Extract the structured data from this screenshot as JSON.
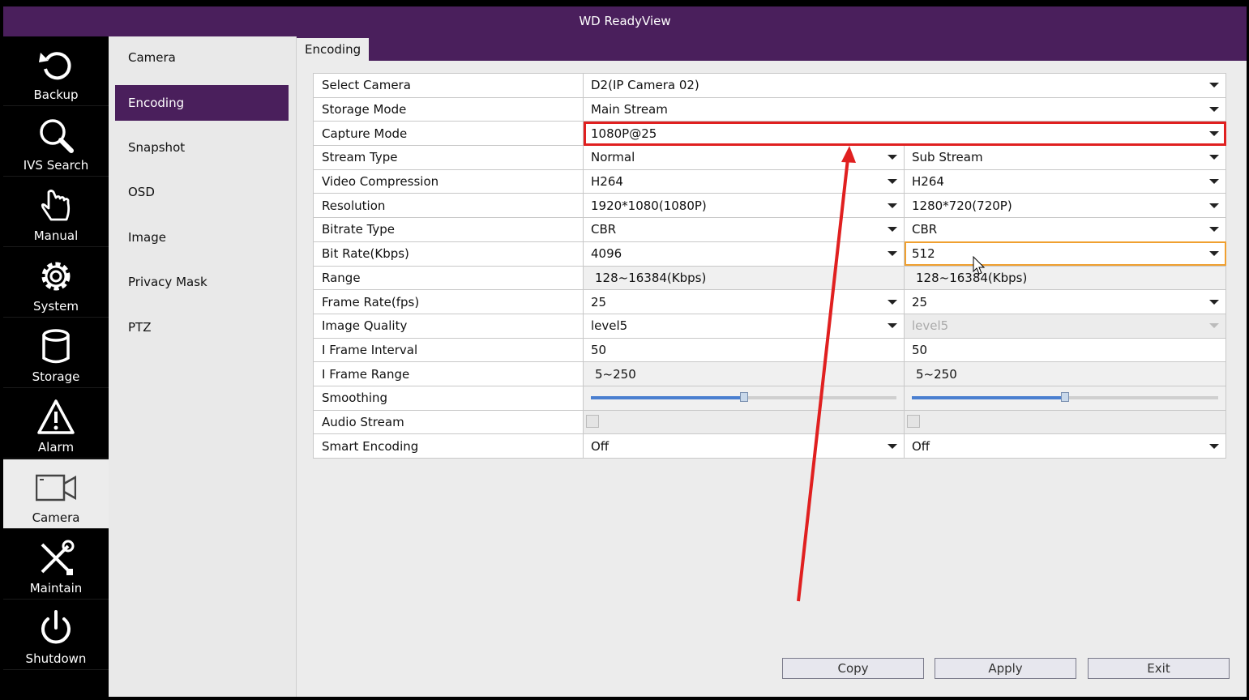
{
  "window": {
    "title": "WD ReadyView"
  },
  "nav": {
    "items": [
      {
        "label": "Backup",
        "icon": "backup-icon"
      },
      {
        "label": "IVS Search",
        "icon": "search-icon"
      },
      {
        "label": "Manual",
        "icon": "hand-icon"
      },
      {
        "label": "System",
        "icon": "gear-icon"
      },
      {
        "label": "Storage",
        "icon": "database-icon"
      },
      {
        "label": "Alarm",
        "icon": "alarm-icon"
      },
      {
        "label": "Camera",
        "icon": "camera-icon",
        "active": true
      },
      {
        "label": "Maintain",
        "icon": "tools-icon"
      },
      {
        "label": "Shutdown",
        "icon": "power-icon"
      }
    ]
  },
  "subnav": {
    "items": [
      {
        "label": "Camera"
      },
      {
        "label": "Encoding",
        "active": true
      },
      {
        "label": "Snapshot"
      },
      {
        "label": "OSD"
      },
      {
        "label": "Image"
      },
      {
        "label": "Privacy Mask"
      },
      {
        "label": "PTZ"
      }
    ]
  },
  "tab": {
    "label": "Encoding"
  },
  "form": {
    "select_camera": {
      "label": "Select Camera",
      "value": "D2(IP Camera 02)"
    },
    "storage_mode": {
      "label": "Storage Mode",
      "value": "Main Stream"
    },
    "capture_mode": {
      "label": "Capture Mode",
      "value": "1080P@25"
    },
    "stream_type": {
      "label": "Stream Type",
      "main": "Normal",
      "sub": "Sub Stream"
    },
    "video_compression": {
      "label": "Video Compression",
      "main": "H264",
      "sub": "H264"
    },
    "resolution": {
      "label": "Resolution",
      "main": "1920*1080(1080P)",
      "sub": "1280*720(720P)"
    },
    "bitrate_type": {
      "label": "Bitrate Type",
      "main": "CBR",
      "sub": "CBR"
    },
    "bit_rate": {
      "label": "Bit Rate(Kbps)",
      "main": "4096",
      "sub": "512"
    },
    "range": {
      "label": "Range",
      "main": "128~16384(Kbps)",
      "sub": "128~16384(Kbps)"
    },
    "frame_rate": {
      "label": "Frame Rate(fps)",
      "main": "25",
      "sub": "25"
    },
    "image_quality": {
      "label": "Image Quality",
      "main": "level5",
      "sub": "level5"
    },
    "i_frame_interval": {
      "label": "I Frame Interval",
      "main": "50",
      "sub": "50"
    },
    "i_frame_range": {
      "label": "I Frame Range",
      "main": "5~250",
      "sub": "5~250"
    },
    "smoothing": {
      "label": "Smoothing",
      "main_level": 0.5,
      "sub_level": 0.5
    },
    "audio_stream": {
      "label": "Audio Stream",
      "main_checked": false,
      "sub_checked": false
    },
    "smart_encoding": {
      "label": "Smart Encoding",
      "main": "Off",
      "sub": "Off"
    }
  },
  "buttons": {
    "copy": "Copy",
    "apply": "Apply",
    "exit": "Exit"
  },
  "annotation": {
    "color": "#e02020"
  }
}
